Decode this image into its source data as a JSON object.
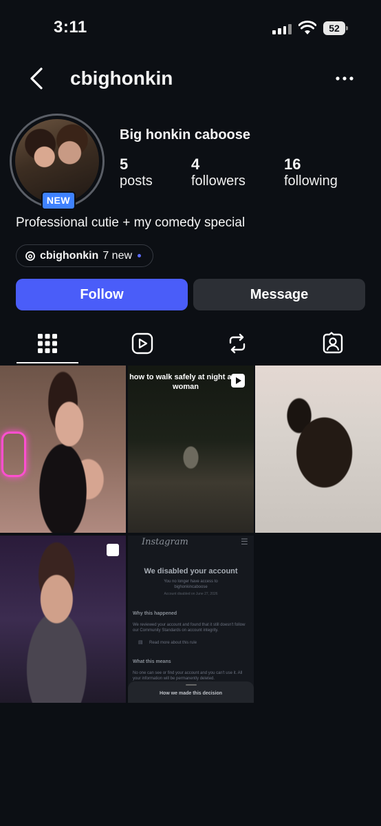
{
  "status_bar": {
    "time": "3:11",
    "battery": "52"
  },
  "header": {
    "username": "cbighonkin"
  },
  "profile": {
    "avatar_badge": "NEW",
    "display_name": "Big honkin caboose",
    "stats": [
      {
        "value": "5",
        "label": "posts"
      },
      {
        "value": "4",
        "label": "followers"
      },
      {
        "value": "16",
        "label": "following"
      }
    ],
    "bio": "Professional cutie + my comedy special",
    "threads": {
      "handle": "cbighonkin",
      "new_count": "7 new"
    }
  },
  "actions": {
    "follow": "Follow",
    "message": "Message"
  },
  "tabs": [
    "grid-icon",
    "reels-icon",
    "reposts-icon",
    "tagged-icon"
  ],
  "posts": [
    {
      "type": "photo"
    },
    {
      "type": "reel",
      "caption": "how to walk safely at night as a woman"
    },
    {
      "type": "photo"
    },
    {
      "type": "carousel"
    },
    {
      "type": "photo",
      "screenshot": {
        "brand": "Instagram",
        "heading": "We disabled your account",
        "line1": "You no longer have access to",
        "line2": "bighonkincaboose",
        "line3": "Account disabled on June 27, 2026",
        "why_title": "Why this happened",
        "why_body": "We reviewed your account and found that it still doesn't follow our Community Standards on account integrity.",
        "read_more": "Read more about this rule",
        "means_title": "What this means",
        "means_body": "No one can see or find your account and you can't use it. All your information will be permanently deleted.",
        "sheet": "How we made this decision"
      }
    }
  ],
  "colors": {
    "accent": "#4a5df9",
    "secondary_button": "#2c2f35",
    "badge": "#3f82ff",
    "background": "#0c0f14"
  }
}
